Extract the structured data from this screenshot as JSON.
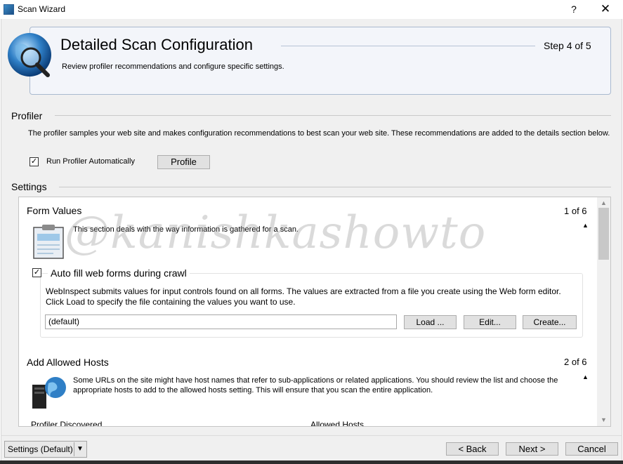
{
  "window": {
    "title": "Scan Wizard",
    "help_glyph": "?",
    "close_glyph": "✕"
  },
  "header": {
    "title": "Detailed Scan Configuration",
    "step": "Step 4 of 5",
    "description": "Review profiler recommendations and configure specific settings."
  },
  "profiler": {
    "section_title": "Profiler",
    "description": "The profiler samples your web site and makes configuration recommendations to best scan your web site. These recommendations are added to the details section below.",
    "run_auto_label": "Run Profiler Automatically",
    "run_auto_checked": true,
    "profile_button": "Profile"
  },
  "settings": {
    "section_title": "Settings",
    "form_values": {
      "title": "Form Values",
      "count": "1 of 6",
      "description": "This section deals with the way information is gathered for a scan.",
      "autofill_label": "Auto fill web forms during crawl",
      "autofill_checked": true,
      "autofill_description": "WebInspect submits values for input controls found on all forms.  The values are extracted from a file you create using the Web form editor.  Click Load to specify the file containing the values you want to use.",
      "file_value": "(default)",
      "load_button": "Load ...",
      "edit_button": "Edit...",
      "create_button": "Create..."
    },
    "allowed_hosts": {
      "title": "Add Allowed Hosts",
      "count": "2 of 6",
      "description": "Some URLs on the site might have host names that refer to sub-applications or related applications. You should review the list and choose the appropriate hosts to add to the allowed hosts setting. This will ensure that you scan the entire application.",
      "col_profiler": "Profiler Discovered",
      "col_allowed": "Allowed Hosts"
    }
  },
  "watermark": "@kanishkashowto",
  "footer": {
    "settings_value": "Settings (Default)",
    "back_button": "< Back",
    "next_button": "Next >",
    "cancel_button": "Cancel"
  },
  "colors": {
    "accent_border": "#a9b9cf",
    "panel_bg": "#f0f0f0",
    "button_bg": "#e1e1e1"
  }
}
